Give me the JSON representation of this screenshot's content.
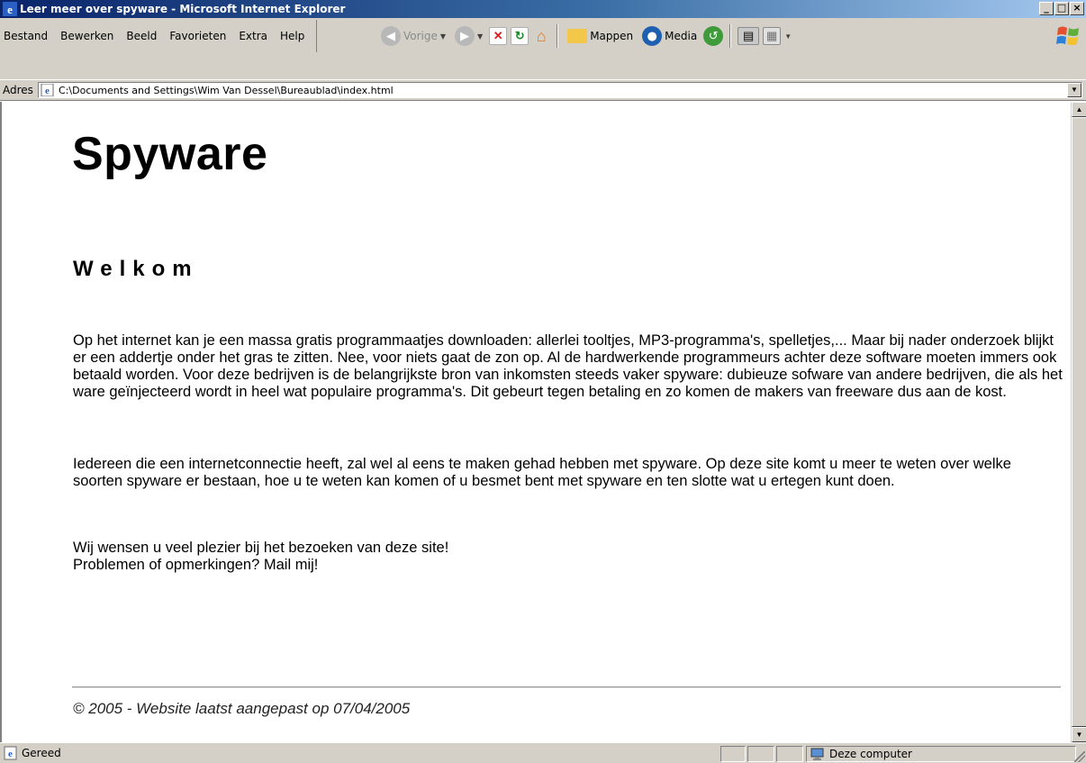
{
  "window": {
    "title": "Leer meer over spyware - Microsoft Internet Explorer",
    "minimize_label": "_",
    "maximize_label": "□",
    "close_label": "×"
  },
  "menu": {
    "items": [
      "Bestand",
      "Bewerken",
      "Beeld",
      "Favorieten",
      "Extra",
      "Help"
    ]
  },
  "toolbar": {
    "back_label": "Vorige",
    "folders_label": "Mappen",
    "media_label": "Media"
  },
  "address": {
    "label": "Adres",
    "url": "C:\\Documents and Settings\\Wim Van Dessel\\Bureaublad\\index.html"
  },
  "page": {
    "title": "Spyware",
    "subtitle": "Welkom",
    "paragraph1": "Op het internet kan je een massa gratis programmaatjes downloaden: allerlei tooltjes, MP3-programma's, spelletjes,... Maar bij nader onderzoek blijkt er een addertje onder het gras te zitten. Nee, voor niets gaat de zon op. Al de hardwerkende programmeurs achter deze software moeten immers ook betaald worden. Voor deze bedrijven is de belangrijkste bron van inkomsten steeds vaker spyware: dubieuze sofware van andere bedrijven, die als het ware geïnjecteerd wordt in heel wat populaire programma's. Dit gebeurt tegen betaling en zo komen de makers van freeware dus aan de kost.",
    "paragraph2": "Iedereen die een internetconnectie heeft, zal wel al eens te maken gehad hebben met spyware. Op deze site komt u meer te weten over welke soorten spyware er bestaan, hoe u te weten kan komen of u besmet bent met spyware en ten slotte wat u ertegen kunt doen.",
    "paragraph3_line1": "Wij wensen u veel plezier bij het bezoeken van deze site!",
    "paragraph3_line2": "Problemen of opmerkingen? Mail mij!",
    "footer": "© 2005 - Website laatst aangepast op 07/04/2005"
  },
  "status": {
    "left_text": "Gereed",
    "zone_text": "Deze computer"
  },
  "colors": {
    "titlebar_start": "#0a246a",
    "titlebar_end": "#a6caf0",
    "chrome": "#d4d0c8"
  }
}
